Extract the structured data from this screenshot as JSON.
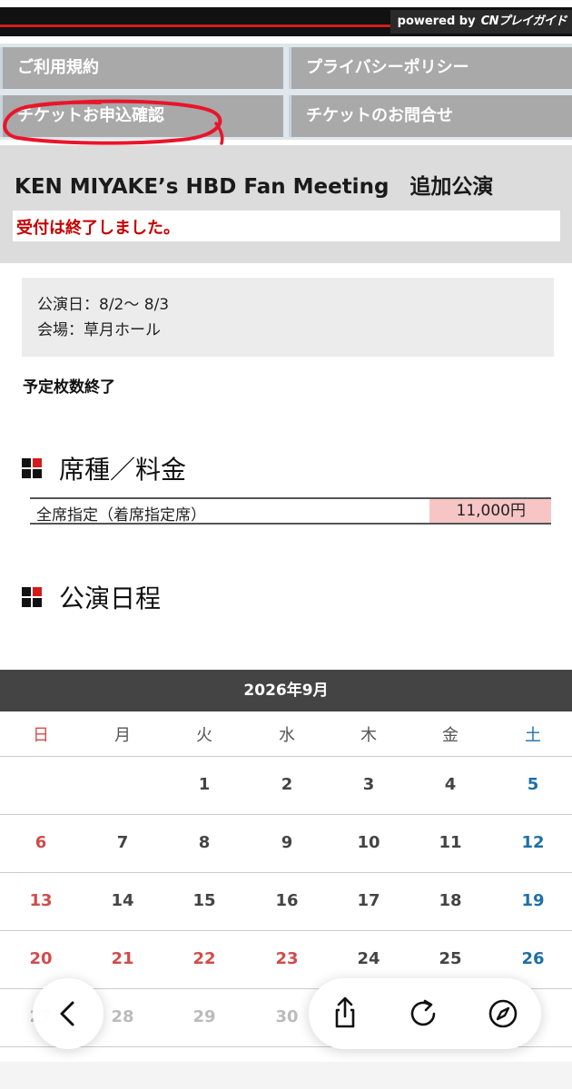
{
  "brand": {
    "powered_by": "powered by",
    "logo_text": "CNプレイガイド"
  },
  "nav": {
    "terms": "ご利用規約",
    "privacy": "プライバシーポリシー",
    "ticket_confirm": "チケットお申込確認",
    "ticket_inquiry": "チケットのお問合せ"
  },
  "event": {
    "title": "KEN MIYAKE’s HBD Fan Meeting　追加公演",
    "status": "受付は終了しました。",
    "dates": "公演日：8/2〜 8/3",
    "venue": "会場：草月ホール",
    "remaining": "予定枚数終了"
  },
  "pricing": {
    "heading": "席種／料金",
    "seat": "全席指定（着席指定席）",
    "price": "11,000円"
  },
  "schedule": {
    "heading": "公演日程"
  },
  "calendar": {
    "month_label": "2026年9月",
    "weekdays": [
      "日",
      "月",
      "火",
      "水",
      "木",
      "金",
      "土"
    ],
    "weeks": [
      [
        "",
        "",
        "1",
        "2",
        "3",
        "4",
        "5"
      ],
      [
        "6",
        "7",
        "8",
        "9",
        "10",
        "11",
        "12"
      ],
      [
        "13",
        "14",
        "15",
        "16",
        "17",
        "18",
        "19"
      ],
      [
        "20",
        "21",
        "22",
        "23",
        "24",
        "25",
        "26"
      ],
      [
        "27",
        "28",
        "29",
        "30",
        "",
        "",
        ""
      ]
    ]
  },
  "colors": {
    "accent_red": "#d41b1b",
    "closed_text": "#c40000",
    "price_bg": "#f7c5c5",
    "saturday": "#1f6fa8",
    "sunday_holiday": "#d24b4b"
  },
  "browser": {
    "icons": [
      "back-icon",
      "share-icon",
      "reload-icon",
      "compass-icon"
    ]
  }
}
